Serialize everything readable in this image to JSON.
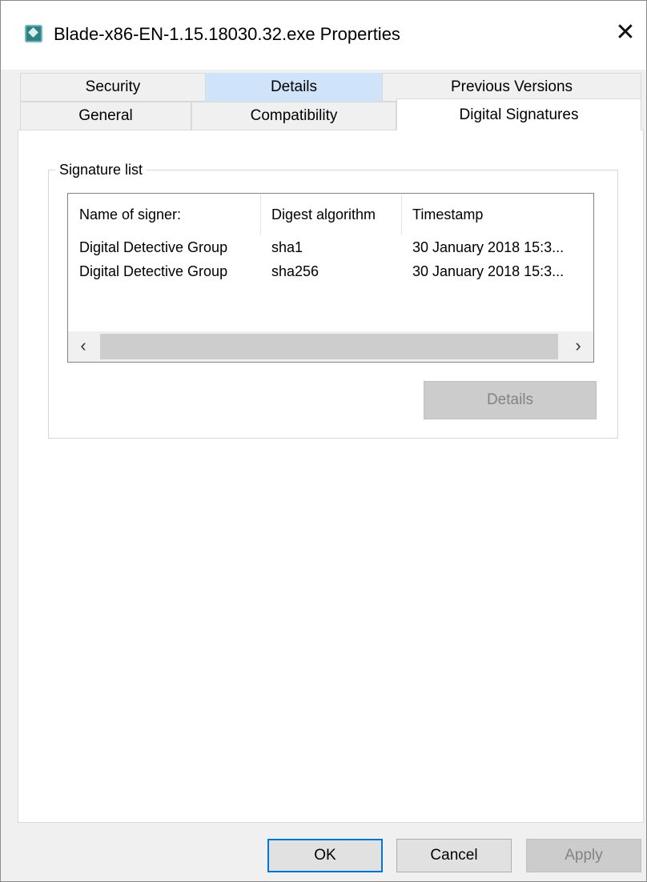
{
  "window": {
    "title": "Blade-x86-EN-1.15.18030.32.exe Properties",
    "close_glyph": "✕",
    "app_icon": "application-icon"
  },
  "tabs": {
    "row1": [
      {
        "label": "Security"
      },
      {
        "label": "Details"
      },
      {
        "label": "Previous Versions"
      }
    ],
    "row2": [
      {
        "label": "General"
      },
      {
        "label": "Compatibility"
      },
      {
        "label": "Digital Signatures"
      }
    ],
    "active": "Digital Signatures",
    "hovered": "Details"
  },
  "signatures": {
    "group_title": "Signature list",
    "columns": [
      "Name of signer:",
      "Digest algorithm",
      "Timestamp"
    ],
    "rows": [
      [
        "Digital Detective Group",
        "sha1",
        "30 January 2018 15:3..."
      ],
      [
        "Digital Detective Group",
        "sha256",
        "30 January 2018 15:3..."
      ]
    ],
    "scroll_left": "‹",
    "scroll_right": "›",
    "details_button": "Details"
  },
  "footer": {
    "ok": "OK",
    "cancel": "Cancel",
    "apply": "Apply"
  },
  "colors": {
    "accent": "#0078d7",
    "tab_hover": "#cfe4f8",
    "dialog_bg": "#f0f0f0"
  }
}
